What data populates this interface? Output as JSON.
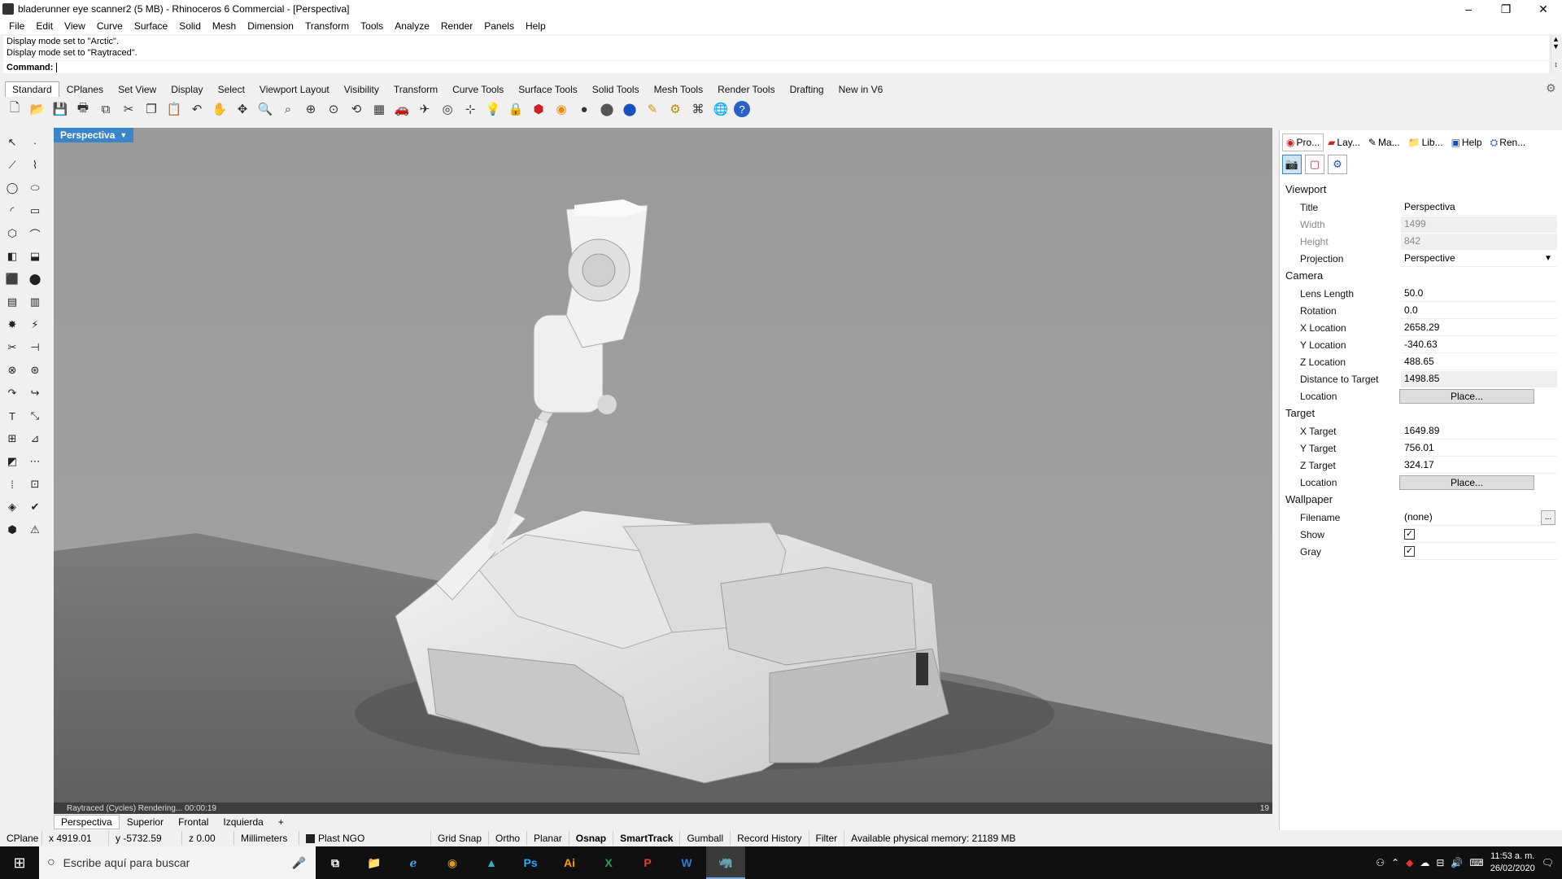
{
  "window": {
    "title": "bladerunner eye scanner2 (5 MB) - Rhinoceros 6 Commercial - [Perspectiva]",
    "controls": {
      "minimize": "–",
      "restore": "❐",
      "close": "✕"
    }
  },
  "menu": [
    "File",
    "Edit",
    "View",
    "Curve",
    "Surface",
    "Solid",
    "Mesh",
    "Dimension",
    "Transform",
    "Tools",
    "Analyze",
    "Render",
    "Panels",
    "Help"
  ],
  "history": [
    "Display mode set to \"Arctic\".",
    "Display mode set to \"Raytraced\"."
  ],
  "command": {
    "label": "Command:",
    "value": ""
  },
  "toolbar_tabs": [
    "Standard",
    "CPlanes",
    "Set View",
    "Display",
    "Select",
    "Viewport Layout",
    "Visibility",
    "Transform",
    "Curve Tools",
    "Surface Tools",
    "Solid Tools",
    "Mesh Tools",
    "Render Tools",
    "Drafting",
    "New in V6"
  ],
  "toolbar_icons": [
    "new-icon",
    "open-icon",
    "save-icon",
    "print-icon",
    "import-icon",
    "cut-icon",
    "copy-icon",
    "paste-icon",
    "undo-icon",
    "pan-icon",
    "rotate-icon",
    "zoom-icon",
    "zoom-window-icon",
    "zoom-extents-icon",
    "zoom-selected-icon",
    "rotate-view-icon",
    "grid-icon",
    "car-icon",
    "plane-icon",
    "circle-icon",
    "snap-icon",
    "light-icon",
    "lock-icon",
    "material-icon",
    "color-wheel-icon",
    "shade-icon",
    "render-sphere-icon",
    "blue-sphere-icon",
    "highlight-icon",
    "gear-icon",
    "options-icon",
    "globe-icon",
    "help-icon"
  ],
  "viewport": {
    "title": "Perspectiva",
    "status": "Raytraced (Cycles)   Rendering...   00:00:19",
    "frame": "19",
    "tabs": [
      "Perspectiva",
      "Superior",
      "Frontal",
      "Izquierda"
    ],
    "add_tab": "+"
  },
  "statusbar": {
    "cplane": "CPlane",
    "x": "x 4919.01",
    "y": "y -5732.59",
    "z": "z 0.00",
    "units": "Millimeters",
    "layer": "Plast NGO",
    "toggles": [
      "Grid Snap",
      "Ortho",
      "Planar",
      "Osnap",
      "SmartTrack",
      "Gumball",
      "Record History",
      "Filter"
    ],
    "memory": "Available physical memory: 21189 MB"
  },
  "panel_tabs": [
    "Pro...",
    "Lay...",
    "Ma...",
    "Lib...",
    "Help",
    "Ren..."
  ],
  "properties": {
    "viewport_section": "Viewport",
    "title_label": "Title",
    "title_value": "Perspectiva",
    "width_label": "Width",
    "width_value": "1499",
    "height_label": "Height",
    "height_value": "842",
    "projection_label": "Projection",
    "projection_value": "Perspective",
    "camera_section": "Camera",
    "lens_label": "Lens Length",
    "lens_value": "50.0",
    "rotation_label": "Rotation",
    "rotation_value": "0.0",
    "xloc_label": "X Location",
    "xloc_value": "2658.29",
    "yloc_label": "Y Location",
    "yloc_value": "-340.63",
    "zloc_label": "Z Location",
    "zloc_value": "488.65",
    "dist_label": "Distance to Target",
    "dist_value": "1498.85",
    "cam_location_label": "Location",
    "cam_place_button": "Place...",
    "target_section": "Target",
    "xt_label": "X Target",
    "xt_value": "1649.89",
    "yt_label": "Y Target",
    "yt_value": "756.01",
    "zt_label": "Z Target",
    "zt_value": "324.17",
    "tgt_location_label": "Location",
    "tgt_place_button": "Place...",
    "wallpaper_section": "Wallpaper",
    "filename_label": "Filename",
    "filename_value": "(none)",
    "filename_button": "...",
    "show_label": "Show",
    "show_checked": true,
    "gray_label": "Gray",
    "gray_checked": true
  },
  "taskbar": {
    "search_placeholder": "Escribe aquí para buscar",
    "apps": [
      "Ps",
      "Ai",
      "X",
      "P",
      "W"
    ],
    "time": "11:53 a. m.",
    "date": "26/02/2020"
  }
}
